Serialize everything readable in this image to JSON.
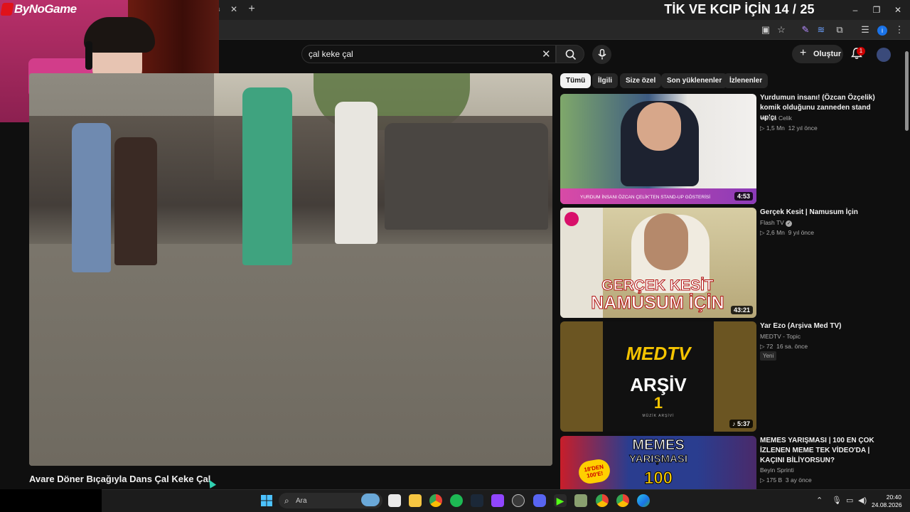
{
  "overlay": {
    "title": "TİK VE KCIP İÇİN 14 / 25",
    "logo_text": "ByNoGame"
  },
  "browser": {
    "tab_stub_text": "ns",
    "tab_close": "✕",
    "new_tab": "+",
    "window_controls": [
      "–",
      "❐",
      "✕"
    ]
  },
  "youtube": {
    "search": {
      "value": "çal keke çal",
      "clear": "✕"
    },
    "create_label": "Oluştur",
    "notification_count": "1",
    "chips": [
      "Tümü",
      "İlgili",
      "Size özel",
      "Son yüklenenler",
      "İzlenenler"
    ],
    "video_title": "Avare Döner Bıçağıyla Dans Çal Keke Çal",
    "related": [
      {
        "title": "Yurdumun insanı! (Özcan Özçelik) komik olduğunu zanneden stand up'çı",
        "channel": "Yunus Celik",
        "views": "▷ 1,5 Mn",
        "age": "12 yıl önce",
        "duration": "4:53",
        "thumb_caption": "YURDUM İNSANI ÖZCAN ÇELİK'TEN STAND-UP GÖSTERİSİ"
      },
      {
        "title": "Gerçek Kesit | Namusum İçin",
        "channel": "Flash TV",
        "views": "▷ 2,6 Mn",
        "age": "9 yıl önce",
        "duration": "43:21",
        "thumb_caption_1": "GERÇEK KESİT",
        "thumb_caption_2": "NAMUSUM İÇİN"
      },
      {
        "title": "Yar Ezo (Arşiva Med TV)",
        "channel": "MEDTV - Topic",
        "views": "▷ 72",
        "age": "16 sa. önce",
        "badge": "Yeni",
        "duration": "♪ 5:37",
        "thumb_logo": "MEDTV",
        "thumb_caption": "ARŞİV",
        "thumb_number": "1",
        "thumb_sub": "MÜZİK ARŞİVİ"
      },
      {
        "title": "MEMES YARIŞMASI | 100 EN ÇOK İZLENEN MEME TEK VİDEO'DA | KAÇINI BİLİYORSUN?",
        "channel": "Beyin Sprinti",
        "views": "▷ 175 B",
        "age": "3 ay önce",
        "thumb_caption_1": "MEMES",
        "thumb_caption_2": "YARIŞMASI",
        "thumb_badge": "18'DEN 100'E!",
        "thumb_number": "100"
      }
    ]
  },
  "taskbar": {
    "search_placeholder": "Ara",
    "time": "20:40",
    "date": "24.08.2026"
  },
  "colors": {
    "background": "#0f0f0f",
    "accent_red": "#cc0000",
    "chip_active": "#f1f1f1"
  }
}
